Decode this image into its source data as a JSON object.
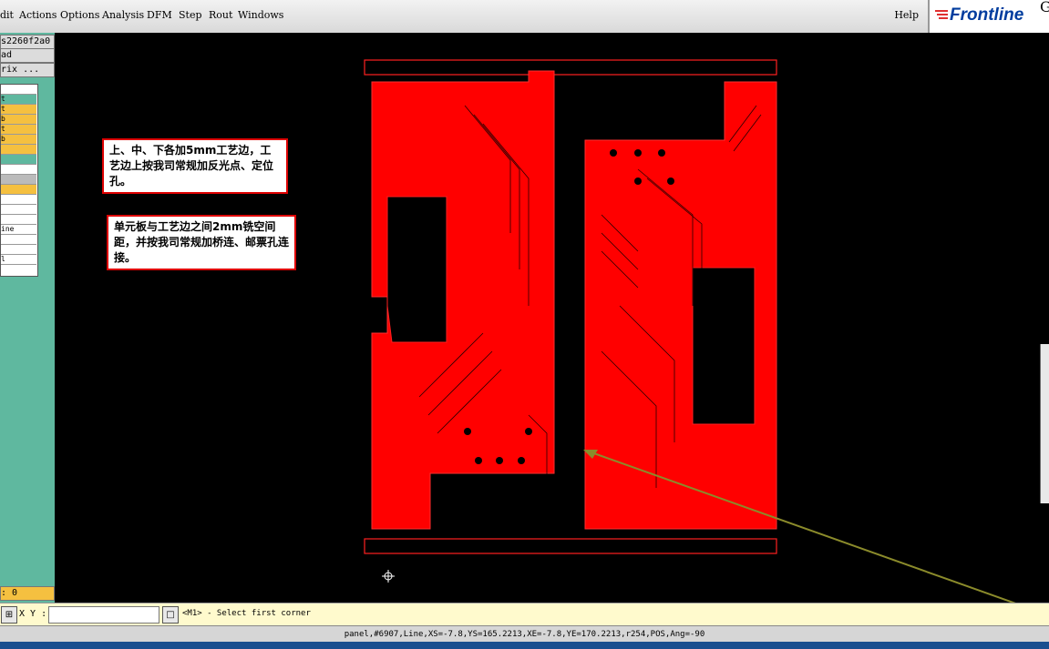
{
  "menubar": {
    "items": [
      "dit",
      "Actions",
      "Options",
      "Analysis",
      "DFM",
      "Step",
      "Rout",
      "Windows"
    ],
    "help": "Help",
    "logo_text": "Frontline",
    "logo_suffix": "G"
  },
  "left_panel": {
    "job_name": "s2260f2a0",
    "step_name": "ad",
    "matrix_button": "rix ...",
    "layers": [
      "",
      "t",
      "b",
      "t",
      "b",
      "",
      "",
      "",
      "",
      "",
      "ine",
      "",
      "",
      "l"
    ],
    "footer_value": ": 0"
  },
  "canvas": {
    "notes": [
      "上、中、下各加5mm工艺边，工艺边上按我司常规加反光点、定位孔。",
      "单元板与工艺边之间2mm铣空间距，并按我司常规加桥连、邮票孔连接。"
    ],
    "colors": {
      "board": "#ff0000",
      "background": "#000000",
      "arrow": "#8b8b2b"
    }
  },
  "command_bar": {
    "xy_label": "X Y :",
    "xy_value": "",
    "prompt": "<M1> - Select first corner"
  },
  "status_bar": {
    "text": "panel,#6907,Line,XS=-7.8,YS=165.2213,XE=-7.8,YE=170.2213,r254,POS,Ang=-90"
  }
}
